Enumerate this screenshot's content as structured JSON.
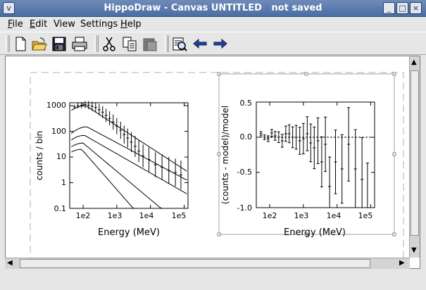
{
  "window": {
    "title": "HippoDraw - Canvas UNTITLED   not saved",
    "controls": [
      "v",
      "_",
      "□",
      "×"
    ]
  },
  "menubar": {
    "items": [
      {
        "label": "File",
        "underline": "F",
        "rest": "ile"
      },
      {
        "label": "Edit",
        "underline": "E",
        "rest": "dit"
      },
      {
        "label": "View",
        "underline": "",
        "rest": "View"
      },
      {
        "label": "Settings",
        "underline": "",
        "rest": "Settings"
      },
      {
        "label": "Help",
        "underline": "H",
        "rest": "elp"
      }
    ]
  },
  "toolbar": {
    "tools": [
      "new-file-icon",
      "open-folder-icon",
      "save-disk-icon",
      "print-icon",
      "cut-icon",
      "copy-icon",
      "paste-icon",
      "inspector-icon",
      "back-arrow-icon",
      "forward-arrow-icon"
    ]
  },
  "left_plot": {
    "ylabel": "counts / bin",
    "xlabel": "Energy (MeV)",
    "yticks": [
      "1000",
      "100",
      "10",
      "1",
      "0.1"
    ],
    "xticks": [
      "1e2",
      "1e3",
      "1e4",
      "1e5"
    ]
  },
  "right_plot": {
    "ylabel": "(counts - model)/model",
    "xlabel": "Energy (MeV)",
    "yticks": [
      "0.5",
      "0.0",
      "-0.5",
      "-1.0"
    ],
    "xticks": [
      "1e2",
      "1e3",
      "1e4",
      "1e5"
    ]
  },
  "chart_data": [
    {
      "type": "scatter",
      "title": "",
      "xlabel": "Energy (MeV)",
      "ylabel": "counts / bin",
      "xscale": "log",
      "yscale": "log",
      "xlim": [
        40,
        130000
      ],
      "ylim": [
        0.1,
        1300
      ],
      "series": [
        {
          "name": "",
          "x": [
            55,
            70,
            90,
            115,
            145,
            185,
            235,
            300,
            380,
            480,
            610,
            780,
            1000,
            1300,
            1650,
            2100,
            2700,
            3500,
            4500,
            6000,
            9000,
            14000,
            22000,
            35000,
            55000,
            80000
          ],
          "y": [
            900,
            1000,
            1050,
            1100,
            1050,
            950,
            850,
            700,
            560,
            420,
            320,
            230,
            160,
            110,
            75,
            55,
            38,
            26,
            17,
            11,
            8,
            5,
            4,
            3,
            2.5,
            2
          ]
        }
      ]
    },
    {
      "type": "scatter",
      "title": "",
      "xlabel": "Energy (MeV)",
      "ylabel": "(counts - model)/model",
      "xscale": "log",
      "xlim": [
        40,
        130000
      ],
      "ylim": [
        -1.0,
        0.5
      ],
      "series": [
        {
          "name": "",
          "x": [
            55,
            70,
            90,
            115,
            145,
            185,
            235,
            300,
            380,
            480,
            610,
            780,
            1000,
            1300,
            1650,
            2100,
            2700,
            3500,
            4500,
            6000,
            9000,
            14000,
            22000,
            35000,
            55000,
            80000
          ],
          "y": [
            0.05,
            0.0,
            -0.02,
            0.06,
            0.02,
            0.0,
            -0.05,
            0.05,
            0.05,
            0.0,
            0.0,
            -0.05,
            -0.02,
            0.05,
            -0.08,
            -0.15,
            -0.05,
            -0.35,
            -0.1,
            -0.7,
            -0.35,
            -0.45,
            -0.1,
            -0.45,
            -0.6,
            -1.0
          ]
        }
      ]
    }
  ]
}
